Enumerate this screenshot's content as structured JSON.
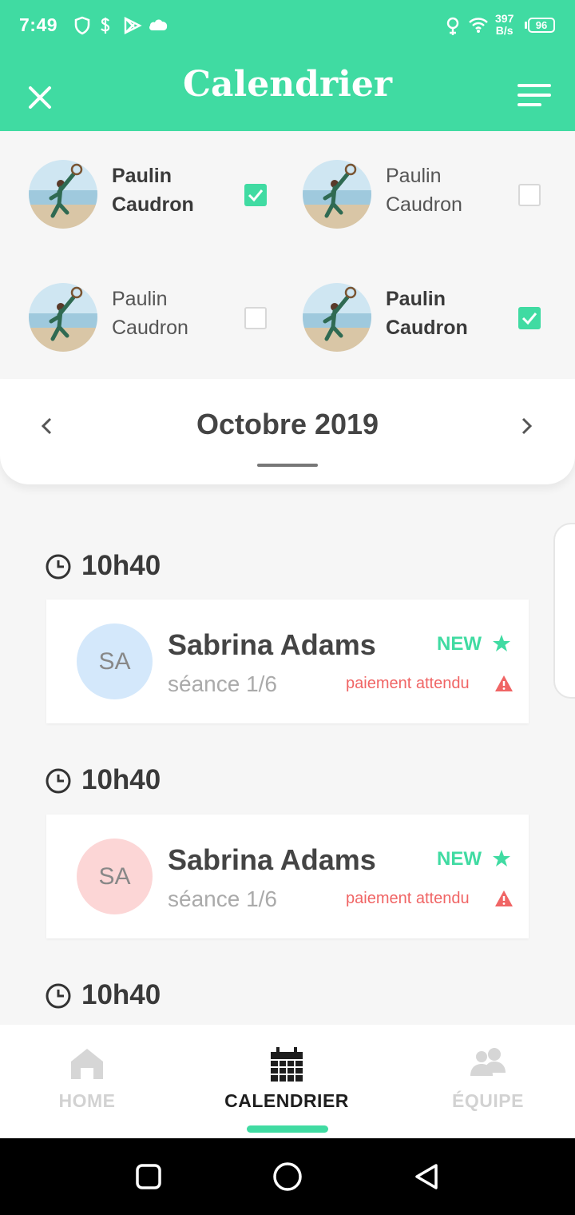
{
  "status_bar": {
    "time": "7:49",
    "net_speed_value": "397",
    "net_speed_unit": "B/s",
    "battery": "96"
  },
  "header": {
    "title": "Calendrier"
  },
  "members": [
    {
      "first": "Paulin",
      "last": "Caudron",
      "checked": true
    },
    {
      "first": "Paulin",
      "last": "Caudron",
      "checked": false
    },
    {
      "first": "Paulin",
      "last": "Caudron",
      "checked": false
    },
    {
      "first": "Paulin",
      "last": "Caudron",
      "checked": true
    }
  ],
  "month": {
    "label": "Octobre 2019"
  },
  "appointments": [
    {
      "time": "10h40",
      "initials": "SA",
      "avatar_color": "#d4e8fb",
      "name": "Sabrina Adams",
      "session": "séance 1/6",
      "badge": "NEW",
      "payment": "paiement attendu"
    },
    {
      "time": "10h40",
      "initials": "SA",
      "avatar_color": "#fcd6d6",
      "name": "Sabrina Adams",
      "session": "séance 1/6",
      "badge": "NEW",
      "payment": "paiement attendu"
    },
    {
      "time": "10h40"
    }
  ],
  "bottom_nav": {
    "home": "HOME",
    "calendar": "CALENDRIER",
    "team": "ÉQUIPE"
  },
  "colors": {
    "accent": "#40dba2",
    "alert": "#f06565"
  }
}
